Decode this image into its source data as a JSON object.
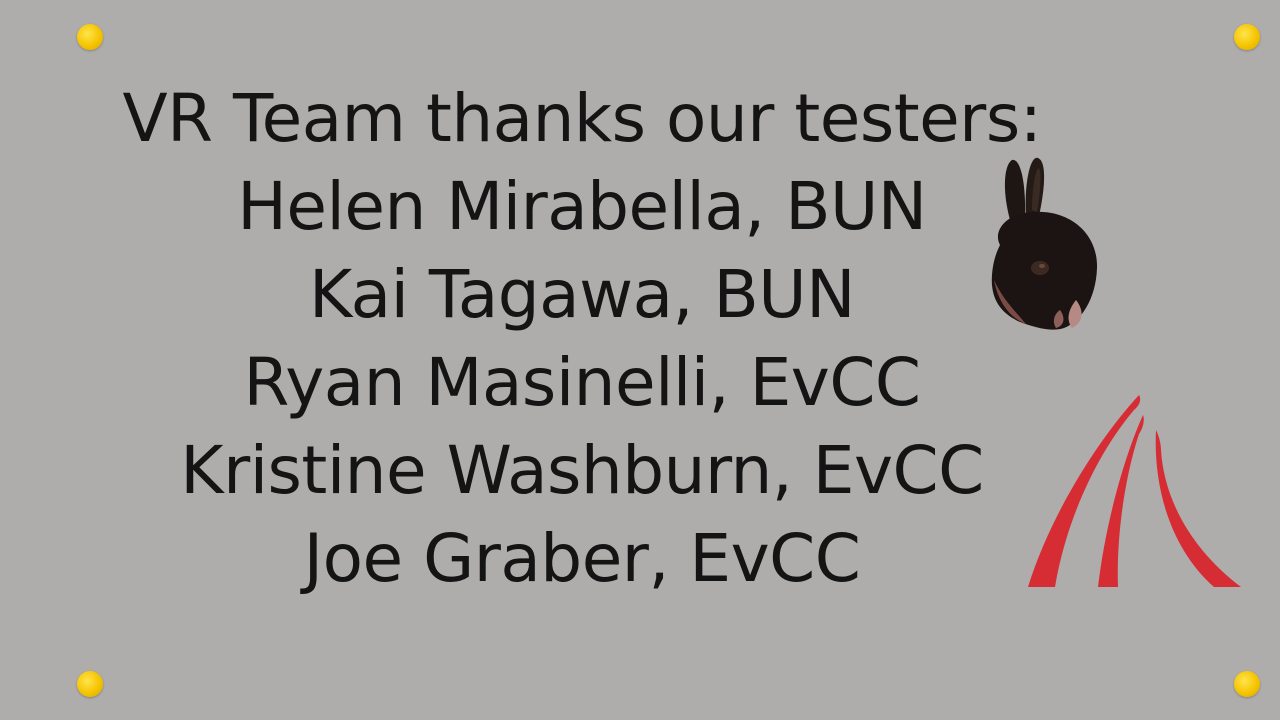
{
  "slide": {
    "lines": [
      "VR Team thanks our testers:",
      "Helen Mirabella, BUN",
      "Kai Tagawa, BUN",
      "Ryan Masinelli, EvCC",
      "Kristine Washburn, EvCC",
      "Joe Graber, EvCC"
    ]
  },
  "decor": {
    "pin_color": "#f5c400",
    "logo_color": "#d62c34",
    "background_color": "#afacac",
    "bunny_icon": "bunny-photo",
    "logo_icon": "red-arc-logo"
  }
}
